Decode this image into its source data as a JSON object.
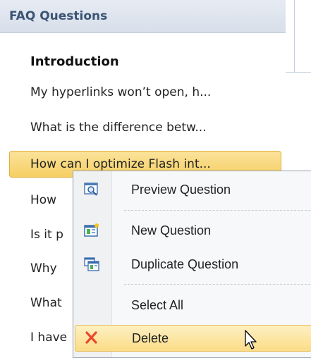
{
  "panel": {
    "title": "FAQ Questions",
    "items": [
      {
        "label": "Introduction"
      },
      {
        "label": "My hyperlinks won’t open, h..."
      },
      {
        "label": "What is the difference betw..."
      },
      {
        "label": "How can I optimize Flash int..."
      },
      {
        "label": "How"
      },
      {
        "label": "Is it p"
      },
      {
        "label": "Why"
      },
      {
        "label": "What"
      },
      {
        "label": "I have"
      }
    ]
  },
  "context_menu": {
    "items": [
      {
        "label": "Preview Question",
        "icon": "preview-icon"
      },
      {
        "label": "New Question",
        "icon": "new-question-icon"
      },
      {
        "label": "Duplicate Question",
        "icon": "duplicate-icon"
      },
      {
        "label": "Select All",
        "icon": ""
      },
      {
        "label": "Delete",
        "icon": "delete-icon"
      }
    ]
  },
  "colors": {
    "selected_item": "#f6cf63",
    "menu_hover": "#fbdc87",
    "delete_icon": "#e8492a",
    "header_text": "#3b5375"
  }
}
